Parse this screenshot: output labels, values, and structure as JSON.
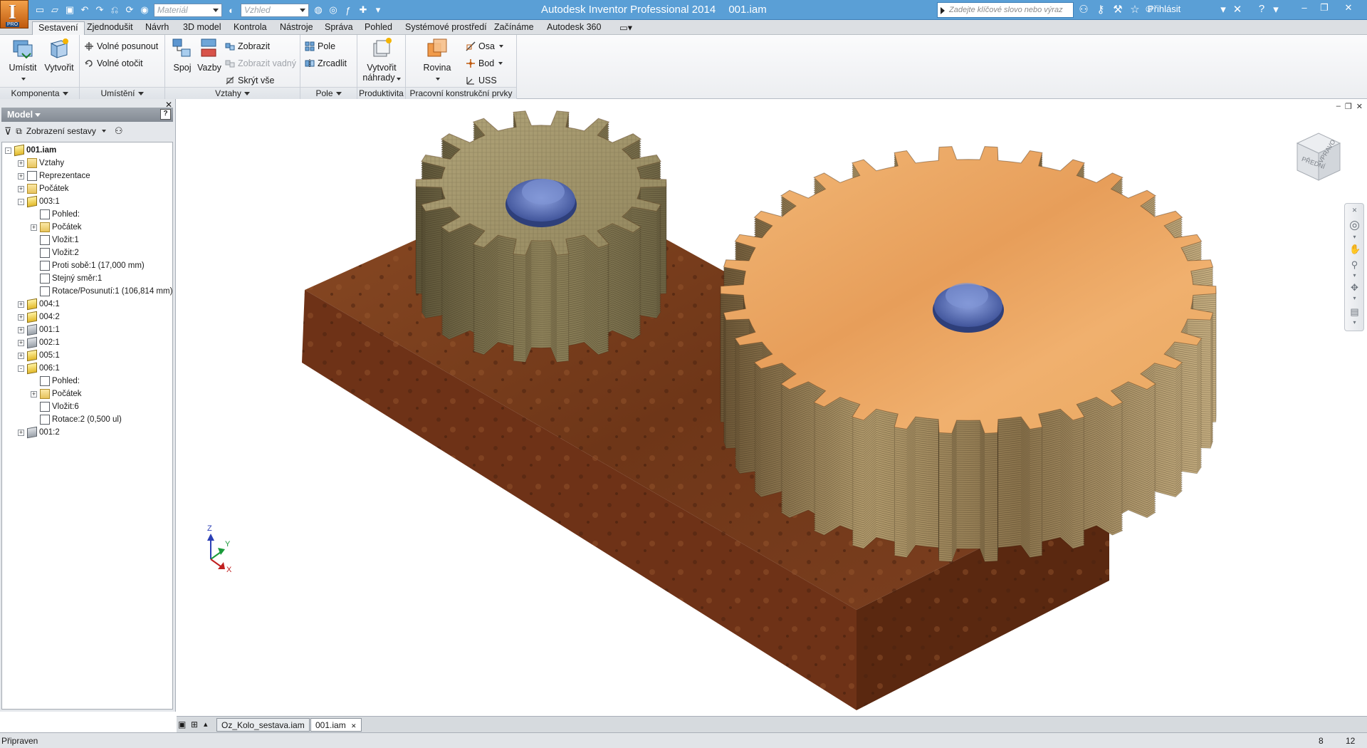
{
  "window": {
    "app_title": "Autodesk Inventor Professional 2014",
    "doc_title": "001.iam",
    "logo_letter": "I",
    "logo_badge": "PRO"
  },
  "quick_access": {
    "material_placeholder": "Materiál",
    "appearance_placeholder": "Vzhled"
  },
  "search": {
    "placeholder": "Zadejte klíčové slovo nebo výraz"
  },
  "user": {
    "signin_label": "Přihlásit"
  },
  "ribbon_tabs": [
    "Sestavení",
    "Zjednodušit",
    "Návrh",
    "3D model",
    "Kontrola",
    "Nástroje",
    "Správa",
    "Pohled",
    "Systémové prostředí",
    "Začínáme",
    "Autodesk 360"
  ],
  "ribbon": {
    "komponenta": {
      "label": "Komponenta",
      "umistit": "Umístit",
      "vytvorit": "Vytvořit"
    },
    "umisteni": {
      "label": "Umístění",
      "volne_posunout": "Volné posunout",
      "volne_otocit": "Volné otočit"
    },
    "vztahy": {
      "label": "Vztahy",
      "spoj": "Spoj",
      "vazby": "Vazby",
      "zobrazit": "Zobrazit",
      "zobrazit_vadny": "Zobrazit vadný",
      "skryt_vse": "Skrýt vše"
    },
    "pole": {
      "label": "Pole",
      "pole": "Pole",
      "zrcadlit": "Zrcadlit"
    },
    "produktivita": {
      "label": "Produktivita",
      "vytvorit_nahrady_1": "Vytvořit",
      "vytvorit_nahrady_2": "náhrady"
    },
    "pracovni": {
      "label": "Pracovní konstrukční prvky",
      "rovina": "Rovina",
      "osa": "Osa",
      "bod": "Bod",
      "uss": "USS"
    }
  },
  "browser": {
    "header": "Model",
    "help": "?",
    "view_mode": "Zobrazení sestavy",
    "tree": [
      {
        "label": "001.iam",
        "level": 0,
        "icon": "assembly",
        "exp": "-"
      },
      {
        "label": "Vztahy",
        "level": 1,
        "icon": "folder",
        "exp": "+"
      },
      {
        "label": "Reprezentace",
        "level": 1,
        "icon": "representation",
        "exp": "+"
      },
      {
        "label": "Počátek",
        "level": 1,
        "icon": "folder",
        "exp": "+"
      },
      {
        "label": "003:1",
        "level": 1,
        "icon": "part-pattern",
        "exp": "-"
      },
      {
        "label": "Pohled:",
        "level": 2,
        "icon": "view",
        "exp": ""
      },
      {
        "label": "Počátek",
        "level": 2,
        "icon": "folder",
        "exp": "+"
      },
      {
        "label": "Vložit:1",
        "level": 2,
        "icon": "insert",
        "exp": ""
      },
      {
        "label": "Vložit:2",
        "level": 2,
        "icon": "insert",
        "exp": ""
      },
      {
        "label": "Proti sobě:1 (17,000 mm)",
        "level": 2,
        "icon": "mate",
        "exp": ""
      },
      {
        "label": "Stejný směr:1",
        "level": 2,
        "icon": "flush",
        "exp": ""
      },
      {
        "label": "Rotace/Posunutí:1 (106,814 mm)",
        "level": 2,
        "icon": "rotate-translate",
        "exp": ""
      },
      {
        "label": "004:1",
        "level": 1,
        "icon": "part",
        "exp": "+"
      },
      {
        "label": "004:2",
        "level": 1,
        "icon": "part",
        "exp": "+"
      },
      {
        "label": "001:1",
        "level": 1,
        "icon": "part-grey",
        "exp": "+"
      },
      {
        "label": "002:1",
        "level": 1,
        "icon": "part-grey",
        "exp": "+"
      },
      {
        "label": "005:1",
        "level": 1,
        "icon": "part",
        "exp": "+"
      },
      {
        "label": "006:1",
        "level": 1,
        "icon": "part",
        "exp": "-"
      },
      {
        "label": "Pohled:",
        "level": 2,
        "icon": "view",
        "exp": ""
      },
      {
        "label": "Počátek",
        "level": 2,
        "icon": "folder",
        "exp": "+"
      },
      {
        "label": "Vložit:6",
        "level": 2,
        "icon": "insert",
        "exp": ""
      },
      {
        "label": "Rotace:2 (0,500 ul)",
        "level": 2,
        "icon": "rotate",
        "exp": ""
      },
      {
        "label": "001:2",
        "level": 1,
        "icon": "part-grey",
        "exp": "+"
      }
    ]
  },
  "viewcube": {
    "face_front": "PŘEDNÍ",
    "face_right": "VPRAVO"
  },
  "triad": {
    "x": "X",
    "y": "Y",
    "z": "Z"
  },
  "document_tabs": [
    "Oz_Kolo_sestava.iam",
    "001.iam"
  ],
  "status": {
    "text": "Připraven",
    "count_1": "8",
    "count_2": "12"
  },
  "colors": {
    "title_bar": "#5a9fd6",
    "wood_gear": "#eaa865",
    "fabric_gear": "#9b8e64",
    "rust_base": "#7a3a1a",
    "hub_blue": "#4a5fa8"
  }
}
